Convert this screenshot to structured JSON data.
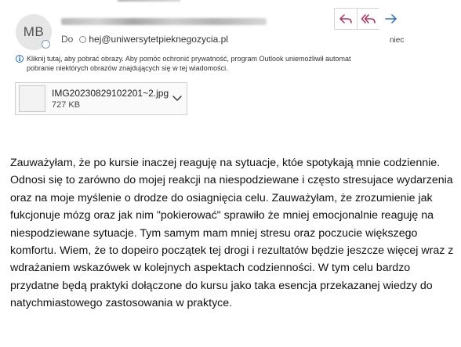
{
  "header": {
    "avatar_initials": "MB",
    "to_label": "Do",
    "recipient": "hej@uniwersytetpieknegozycia.pl",
    "date_partial": "niec",
    "actions": [
      {
        "name": "reply",
        "icon": "reply-icon"
      },
      {
        "name": "reply-all",
        "icon": "reply-all-icon"
      },
      {
        "name": "forward",
        "icon": "forward-icon"
      }
    ],
    "accent_color": "#b0305c"
  },
  "info_bar": {
    "icon": "info-icon",
    "line1": "Kliknij tutaj, aby pobrać obrazy. Aby pomóc ochronić prywatność, program Outlook uniemożliwił automat",
    "line2": "pobranie niektórych obrazów znajdujących się w tej wiadomości."
  },
  "attachment": {
    "filename": "IMG20230829102201~2.jpg",
    "size": "727 KB"
  },
  "body": {
    "paragraph": "Zauważyłam, że po kursie inaczej reaguję na sytuacje, któe spotykają mnie codziennie. Odnosi się to zarówno do mojej reakcji na niespodziewane i często stresujace wydarzenia oraz na moje myślenie o drodze do osiagnięcia celu. Zauważyłam, że zrozumienie jak fukcjonuje mózg oraz jak nim \"pokierować\" sprawiło że mniej emocjonalnie reaguję na niespodziewane sytuacje. Tym samym mam mniej stresu oraz poczucie większego komfortu. Wiem, że to dopeiro początek tej drogi i rezultatów będzie jeszcze więcej wraz z wdrażaniem wskazówek w kolejnych aspektach codzienności. W tym celu bardzo przydatne będą praktyki dołączone do kursu jako taka esencja przekazanej wiedzy do natychmiastowego zastosowania w praktyce."
  }
}
